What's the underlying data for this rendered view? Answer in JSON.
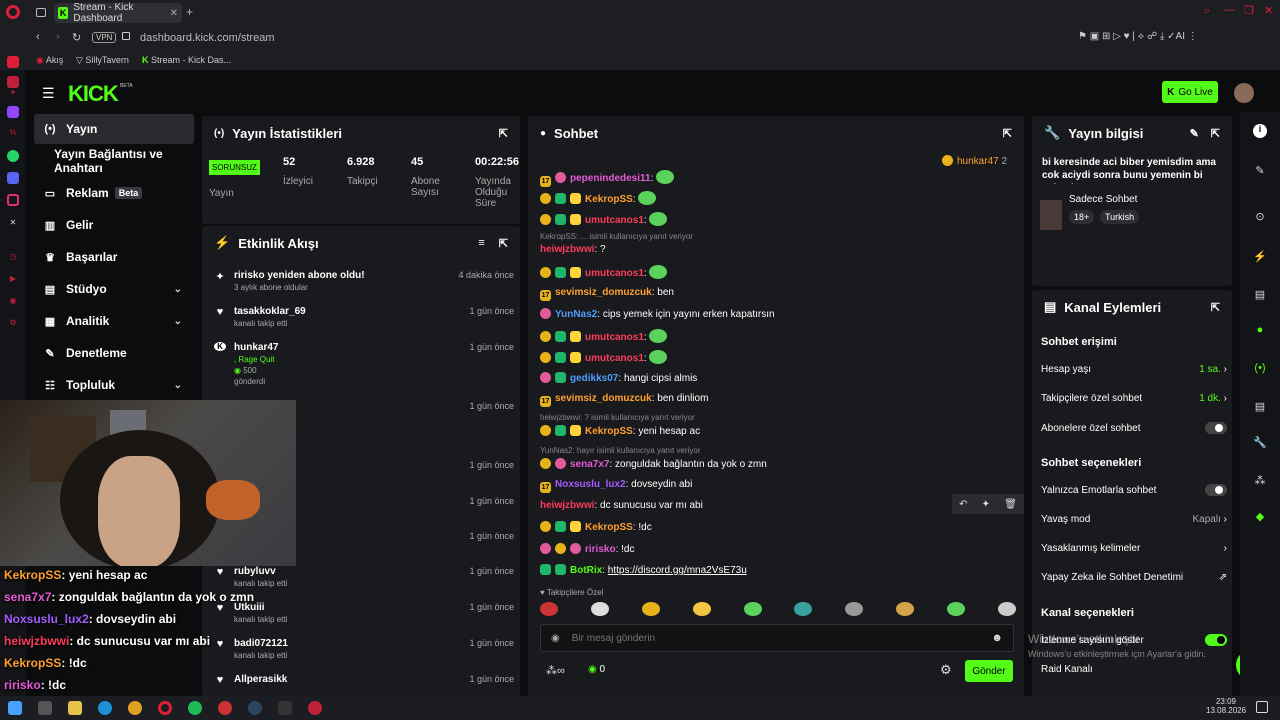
{
  "browser": {
    "tab_title": "Stream - Kick Dashboard",
    "url": "dashboard.kick.com/stream",
    "vpn": "VPN",
    "bookmarks": [
      "Akış",
      "SillyTavern",
      "Stream - Kick Das..."
    ]
  },
  "header": {
    "logo": "KICK",
    "beta": "BETA",
    "go_live": "Go Live"
  },
  "nav": [
    {
      "label": "Yayın",
      "icon": "broadcast-icon"
    },
    {
      "label": "Yayın Bağlantısı ve Anahtarı"
    },
    {
      "label": "Reklam",
      "badge": "Beta"
    },
    {
      "label": "Gelir"
    },
    {
      "label": "Başarılar"
    },
    {
      "label": "Stüdyo"
    },
    {
      "label": "Analitik"
    },
    {
      "label": "Denetleme"
    },
    {
      "label": "Topluluk"
    }
  ],
  "stats": {
    "title": "Yayın İstatistikleri",
    "status": "SORUNSUZ",
    "status_label": "Yayın",
    "viewers": "52",
    "viewers_label": "İzleyici",
    "followers": "6.928",
    "followers_label": "Takipçi",
    "subs": "45",
    "subs_label": "Abone Sayısı",
    "uptime": "00:22:56",
    "uptime_label": "Yayında Olduğu Süre"
  },
  "activity": {
    "title": "Etkinlik Akışı",
    "events": [
      {
        "name": "ririsko yeniden abone oldu!",
        "sub": "3 aylık abone oldular",
        "time": "4 dakika önce",
        "icon": "star-icon"
      },
      {
        "name": "tasakkoklar_69",
        "sub": "kanalı takip etti",
        "time": "1 gün önce",
        "icon": "heart-icon"
      },
      {
        "name": "hunkar47",
        "sub": ", Rage Quit",
        "extra": "500",
        "extra2": "gönderdi",
        "time": "1 gün önce",
        "icon": "kick-icon"
      },
      {
        "name": "",
        "sub": "",
        "time": "1 gün önce"
      },
      {
        "name": "",
        "sub": "",
        "time": "1 gün önce"
      },
      {
        "name": "",
        "sub": "",
        "time": "1 gün önce"
      },
      {
        "name": "",
        "sub": "",
        "time": "1 gün önce"
      },
      {
        "name": "rubyluvv",
        "sub": "kanalı takip etti",
        "time": "1 gün önce",
        "icon": "heart-icon"
      },
      {
        "name": "Utkuiii",
        "sub": "kanalı takip etti",
        "time": "1 gün önce",
        "icon": "heart-icon"
      },
      {
        "name": "badi072121",
        "sub": "kanalı takip etti",
        "time": "1 gün önce",
        "icon": "heart-icon"
      },
      {
        "name": "Allperasikk",
        "sub": "",
        "time": "1 gün önce",
        "icon": "heart-icon"
      }
    ]
  },
  "chat": {
    "title": "Sohbet",
    "pinned_user": "hunkar47",
    "pinned_count": "2",
    "followers_only": "Takipçilere Özel",
    "placeholder": "Bir mesaj gönderin",
    "send": "Gönder",
    "kick_count": "0",
    "messages": [
      {
        "user": "pepenindedesi11",
        "color": "#e35bd7",
        "text": "",
        "badges": [
          "b17",
          "bpink"
        ]
      },
      {
        "user": "KekropSS",
        "color": "#ffa030",
        "text": "",
        "badges": [
          "bgold",
          "bgreen",
          "bmod"
        ]
      },
      {
        "user": "umutcanos1",
        "color": "#ff3b5c",
        "text": "",
        "badges": [
          "bgold",
          "bgreen",
          "bmod"
        ]
      },
      {
        "reply": "KekropSS: ... isimli kullanıcıya yanıt veriyor"
      },
      {
        "user": "heiwjzbwwi",
        "color": "#ff3b5c",
        "text": "?",
        "badges": []
      },
      {
        "user": "umutcanos1",
        "color": "#ff3b5c",
        "text": "",
        "badges": [
          "bgold",
          "bgreen",
          "bmod"
        ]
      },
      {
        "user": "sevimsiz_domuzcuk",
        "color": "#ffa030",
        "text": "ben",
        "badges": [
          "b17"
        ]
      },
      {
        "user": "YunNas2",
        "color": "#4f9cff",
        "text": "cips yemek için yayını erken kapatırsın",
        "badges": [
          "bpink"
        ]
      },
      {
        "user": "umutcanos1",
        "color": "#ff3b5c",
        "text": "",
        "badges": [
          "bgold",
          "bgreen",
          "bmod"
        ]
      },
      {
        "user": "umutcanos1",
        "color": "#ff3b5c",
        "text": "",
        "badges": [
          "bgold",
          "bgreen",
          "bmod"
        ]
      },
      {
        "user": "gedikks07",
        "color": "#4f9cff",
        "text": "hangi cipsi almis",
        "badges": [
          "bpink",
          "bgreen"
        ]
      },
      {
        "user": "sevimsiz_domuzcuk",
        "color": "#ffa030",
        "text": "ben dinliom",
        "badges": [
          "b17"
        ]
      },
      {
        "reply": "heiwjzbwwi: ? isimli kullanıcıya yanıt veriyor"
      },
      {
        "user": "KekropSS",
        "color": "#ffa030",
        "text": "yeni hesap ac",
        "badges": [
          "bgold",
          "bgreen",
          "bmod"
        ]
      },
      {
        "reply": "YunNas2: hayır isimli kullanıcıya yanıt veriyor"
      },
      {
        "user": "sena7x7",
        "color": "#e35bd7",
        "text": "zonguldak bağlantın da yok o zmn",
        "badges": [
          "bgold",
          "bpink"
        ]
      },
      {
        "user": "Noxsuslu_lux2",
        "color": "#a55bff",
        "text": "dovseydin abi",
        "badges": [
          "b17"
        ]
      },
      {
        "user": "heiwjzbwwi",
        "color": "#ff3b5c",
        "text": "dc sunucusu var mı abi",
        "badges": []
      },
      {
        "user": "KekropSS",
        "color": "#ffa030",
        "text": "!dc",
        "badges": [
          "bgold",
          "bgreen",
          "bmod"
        ]
      },
      {
        "user": "ririsko",
        "color": "#e35bd7",
        "text": "!dc",
        "badges": [
          "bpink",
          "bgold",
          "bpink"
        ]
      },
      {
        "user": "BotRix",
        "color": "#53fc18",
        "text": "https://discord.gg/mna2VsE73u",
        "badges": [
          "bgreen",
          "bgreen"
        ]
      }
    ]
  },
  "info": {
    "title": "Yayın bilgisi",
    "desc": "bi keresinde aci biber yemisdim ama cok aciydi sonra bunu yemenin bi anlami y...",
    "category": "Sadece Sohbet",
    "tags": [
      "18+",
      "Turkish"
    ]
  },
  "actions": {
    "title": "Kanal Eylemleri",
    "chat_access": "Sohbet erişimi",
    "account_age": "Hesap yaşı",
    "account_age_val": "1 sa.",
    "follower_chat": "Takipçilere özel sohbet",
    "follower_chat_val": "1 dk.",
    "sub_chat": "Abonelere özel sohbet",
    "chat_options": "Sohbet seçenekleri",
    "emote_only": "Yalnızca Emotlarla sohbet",
    "slow": "Yavaş mod",
    "slow_val": "Kapalı",
    "banned_words": "Yasaklanmış kelimeler",
    "ai_mod": "Yapay Zeka ile Sohbet Denetimi",
    "channel_options": "Kanal seçenekleri",
    "show_viewers": "İzlenme sayısını göster",
    "raid": "Raid Kanalı",
    "win_activate": "Windows'u etkinleştir",
    "win_activate2": "Windows'u etkinleştirmek için Ayarlar'a gidin."
  },
  "overlay": [
    {
      "user": "KekropSS",
      "color": "#ffa030",
      "text": ": yeni hesap ac"
    },
    {
      "user": "sena7x7",
      "color": "#e35bd7",
      "text": ": zonguldak bağlantın da yok o zmn"
    },
    {
      "user": "Noxsuslu_lux2",
      "color": "#a55bff",
      "text": ": dovseydin abi"
    },
    {
      "user": "heiwjzbwwi",
      "color": "#ff3b5c",
      "text": ": dc sunucusu var mı abi"
    },
    {
      "user": "KekropSS",
      "color": "#ffa030",
      "text": ": !dc"
    },
    {
      "user": "ririsko",
      "color": "#e35bd7",
      "text": ": !dc"
    },
    {
      "user": "BotRix",
      "color": "#53fc18",
      "text": ": https://discord.gg/mna2VsE73u"
    }
  ],
  "taskbar": {
    "time": "23:09",
    "date": "13.08.2026"
  }
}
